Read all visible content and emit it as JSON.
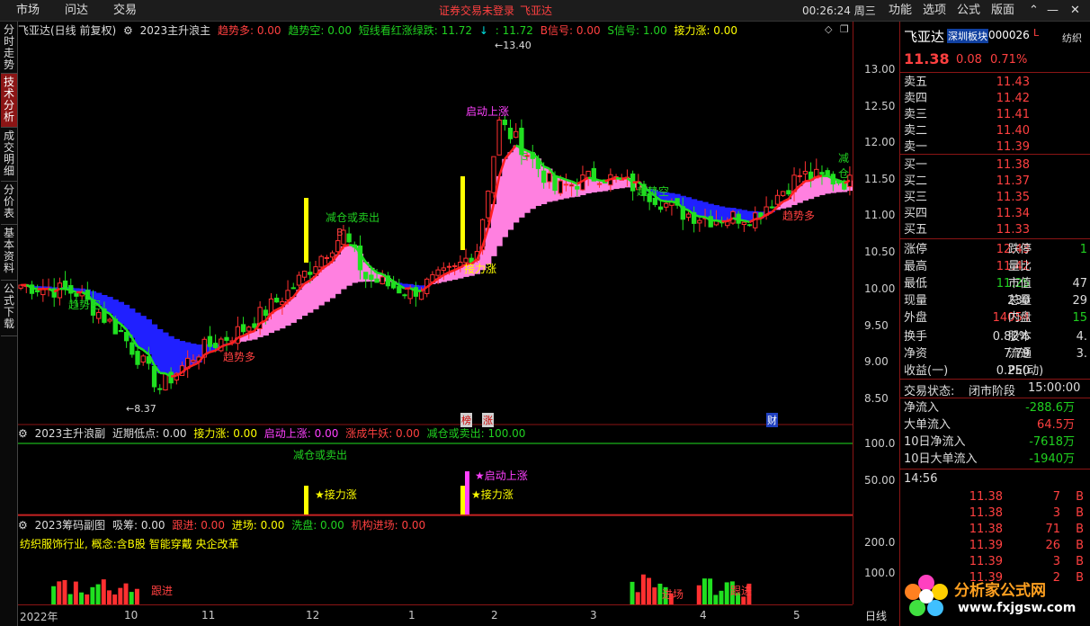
{
  "topbar": {
    "menu_market": "市场",
    "menu_ask": "问达",
    "menu_trade": "交易",
    "login_status": "证券交易未登录",
    "stock_name": "飞亚达",
    "clock": "00:26:24 周三",
    "menu_func": "功能",
    "menu_options": "选项",
    "menu_formula": "公式",
    "menu_layout": "版面"
  },
  "lefttabs": [
    "分时走势",
    "技术分析",
    "成交明细",
    "分价表",
    "基本资料",
    "公式下载"
  ],
  "main_title": {
    "name": "飞亚达(日线 前复权)",
    "indicator": "2023主升浪主",
    "trend_up": "趋势多: 0.00",
    "trend_down": "趋势空: 0.00",
    "short": "短线看红涨绿跌: 11.72",
    "val2": ": 11.72",
    "bsig": "B信号: 0.00",
    "ssig": "S信号: 1.00",
    "relay": "接力涨: 0.00"
  },
  "price_ticks": [
    "13.00",
    "12.50",
    "12.00",
    "11.50",
    "11.00",
    "10.50",
    "10.00",
    "9.50",
    "9.00",
    "8.50"
  ],
  "chart_annotations": {
    "high": "←13.40",
    "low": "←8.37",
    "start": "启动上涨",
    "reduce": "减仓或卖出",
    "relay": "接力涨",
    "trend_down1": "趋势空",
    "trend_up1": "趋势多",
    "trend_down2": "趋势空",
    "trend_up2": "趋势多",
    "reduce2": "减仓",
    "s_mark": "S",
    "b_mark": "B"
  },
  "event_marks": {
    "m1": "榜",
    "m2": "涨",
    "m3": "财"
  },
  "sub1": {
    "title": "2023主升浪副",
    "low": "近期低点: 0.00",
    "relay": "接力涨: 0.00",
    "start": "启动上涨: 0.00",
    "bull": "涨成牛妖: 0.00",
    "reduce": "减仓或卖出: 100.00",
    "star_relay": "★接力涨",
    "star_start": "★启动上涨",
    "reduce_label": "减仓或卖出",
    "ticks": [
      "100.0",
      "50.00"
    ]
  },
  "sub2": {
    "title": "2023筹码副图",
    "absorb": "吸筹: 0.00",
    "follow": "跟进: 0.00",
    "enter": "进场: 0.00",
    "wash": "洗盘: 0.00",
    "inst": "机构进场: 0.00",
    "sector": "纺织服饰行业, 概念:含B股 智能穿戴 央企改革",
    "ticks": [
      "200.0",
      "100.0"
    ],
    "follow_label": "跟进",
    "enter_label": "进场"
  },
  "xaxis": [
    "2022年",
    "10",
    "11",
    "12",
    "1",
    "2",
    "3",
    "4",
    "5"
  ],
  "period": "日线",
  "quote": {
    "name": "飞亚达",
    "board": "深圳板块",
    "code": "000026",
    "mark": "L",
    "price": "11.38",
    "change": "0.08",
    "pct": "0.71%",
    "sell": [
      [
        "卖五",
        "11.43"
      ],
      [
        "卖四",
        "11.42"
      ],
      [
        "卖三",
        "11.41"
      ],
      [
        "卖二",
        "11.40"
      ],
      [
        "卖一",
        "11.39"
      ]
    ],
    "buy": [
      [
        "买一",
        "11.38"
      ],
      [
        "买二",
        "11.37"
      ],
      [
        "买三",
        "11.35"
      ],
      [
        "买四",
        "11.34"
      ],
      [
        "买五",
        "11.33"
      ]
    ],
    "stats": [
      [
        "涨停",
        "12.43",
        "跌停",
        "1"
      ],
      [
        "最高",
        "11.42",
        "量比",
        ""
      ],
      [
        "最低",
        "11.25",
        "市值",
        "47"
      ],
      [
        "现量",
        "230",
        "总量",
        "29"
      ],
      [
        "外盘",
        "14054",
        "内盘",
        "15"
      ],
      [
        "换手",
        "0.82%",
        "股本",
        "4."
      ],
      [
        "净资",
        "7.79",
        "流通",
        "3."
      ],
      [
        "收益(一)",
        "0.250",
        "PE(动)",
        ""
      ]
    ],
    "state_label": "交易状态:",
    "state": "闭市阶段",
    "state_time": "15:00:00",
    "flows": [
      [
        "净流入",
        "-288.6万"
      ],
      [
        "大单流入",
        "64.5万"
      ],
      [
        "10日净流入",
        "-7618万"
      ],
      [
        "10日大单流入",
        "-1940万"
      ]
    ],
    "ticks_time": "14:56",
    "trades": [
      [
        "11.38",
        "7",
        "B"
      ],
      [
        "11.38",
        "3",
        "B"
      ],
      [
        "11.38",
        "71",
        "B"
      ],
      [
        "11.39",
        "26",
        "B"
      ],
      [
        "11.39",
        "3",
        "B"
      ],
      [
        "11.39",
        "2",
        "B"
      ]
    ],
    "side": "纺织"
  },
  "logo": {
    "text1": "分析家公式网",
    "text2": "www.fxjgsw.com"
  },
  "colors": {
    "up": "#ff3030",
    "down": "#20e020",
    "pink": "#ff80e0",
    "blue": "#2020ff",
    "yellow": "#ffff00",
    "magenta": "#ff40ff"
  }
}
